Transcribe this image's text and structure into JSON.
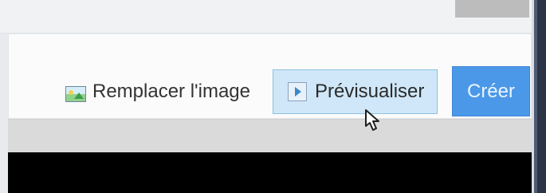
{
  "toolbar": {
    "replace_image_label": "Remplacer l'image",
    "preview_label": "Prévisualiser",
    "create_label": "Créer"
  },
  "icons": {
    "replace_image": "image-icon",
    "preview": "play-icon",
    "cursor": "mouse-cursor-icon"
  },
  "colors": {
    "preview_bg": "#cfe7f8",
    "preview_border": "#8ebfe2",
    "create_bg": "#4b98e8",
    "create_text": "#eaf5ff"
  }
}
